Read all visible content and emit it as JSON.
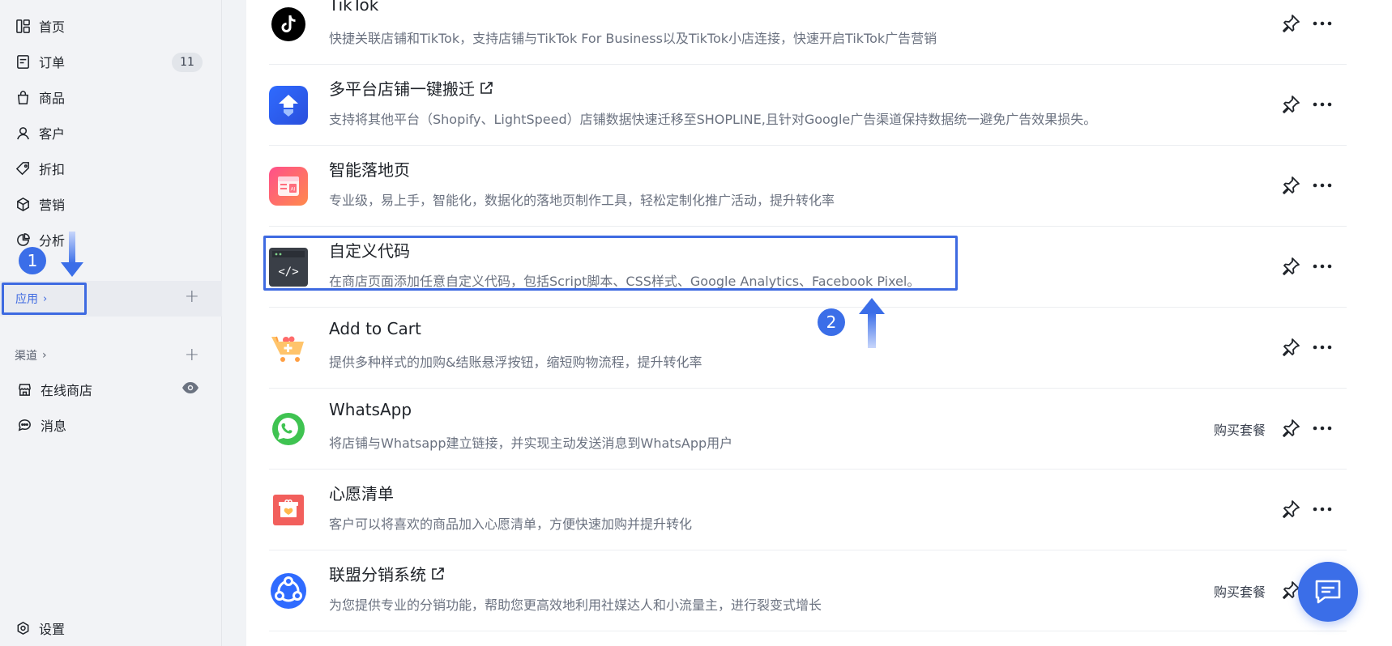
{
  "sidebar": {
    "nav": [
      {
        "label": "首页",
        "icon": "dashboard-icon"
      },
      {
        "label": "订单",
        "icon": "order-icon",
        "badge": "11"
      },
      {
        "label": "商品",
        "icon": "bag-icon"
      },
      {
        "label": "客户",
        "icon": "user-icon"
      },
      {
        "label": "折扣",
        "icon": "tag-icon"
      },
      {
        "label": "营销",
        "icon": "cube-icon"
      },
      {
        "label": "分析",
        "icon": "pie-chart-icon"
      }
    ],
    "apps_label": "应用",
    "channels_label": "渠道",
    "channels": [
      {
        "label": "在线商店",
        "icon": "store-icon"
      },
      {
        "label": "消息",
        "icon": "message-icon"
      }
    ],
    "settings_label": "设置"
  },
  "annotations": {
    "marker1": "1",
    "marker2": "2",
    "accent_color": "#3e6ae1"
  },
  "apps": [
    {
      "name": "TikTok",
      "desc": "快捷关联店铺和TikTok，支持店铺与TikTok For Business以及TikTok小店连接，快速开启TikTok广告营销",
      "icon": "tiktok-icon"
    },
    {
      "name": "多平台店铺一键搬迁",
      "desc": "支持将其他平台（Shopify、LightSpeed）店铺数据快速迁移至SHOPLINE,且针对Google广告渠道保持数据统一避免广告效果损失。",
      "icon": "migrate-icon",
      "external": true
    },
    {
      "name": "智能落地页",
      "desc": "专业级，易上手，智能化，数据化的落地页制作工具，轻松定制化推广活动，提升转化率",
      "icon": "ai-landing-icon"
    },
    {
      "name": "自定义代码",
      "desc": "在商店页面添加任意自定义代码，包括Script脚本、CSS样式、Google Analytics、Facebook Pixel。",
      "icon": "code-icon"
    },
    {
      "name": "Add to Cart",
      "desc": "提供多种样式的加购&结账悬浮按钮，缩短购物流程，提升转化率",
      "icon": "cart-icon"
    },
    {
      "name": "WhatsApp",
      "desc": "将店铺与Whatsapp建立链接，并实现主动发送消息到WhatsApp用户",
      "icon": "whatsapp-icon",
      "buy": "购买套餐"
    },
    {
      "name": "心愿清单",
      "desc": "客户可以将喜欢的商品加入心愿清单，方便快速加购并提升转化",
      "icon": "wishlist-icon"
    },
    {
      "name": "联盟分销系统",
      "desc": "为您提供专业的分销功能，帮助您更高效地利用社媒达人和小流量主，进行裂变式增长",
      "icon": "affiliate-icon",
      "external": true,
      "buy": "购买套餐"
    }
  ]
}
